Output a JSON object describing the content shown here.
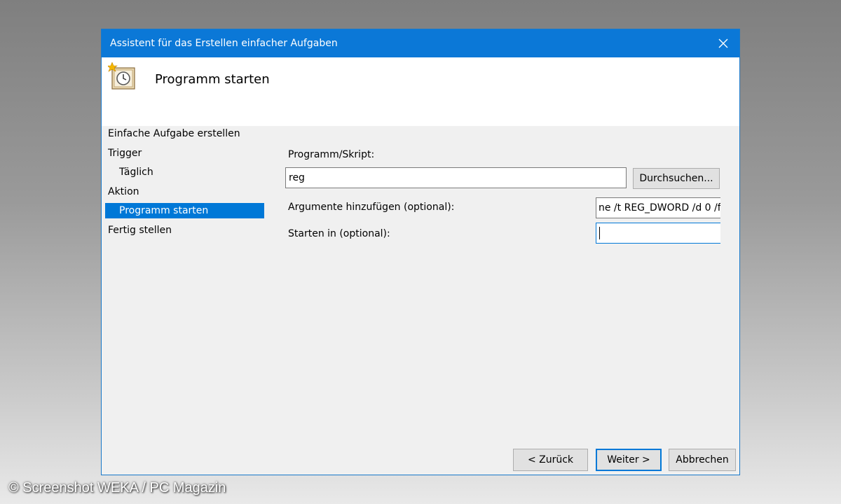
{
  "window": {
    "title": "Assistent für das Erstellen einfacher Aufgaben",
    "close_icon": "close-icon"
  },
  "header": {
    "title": "Programm starten",
    "icon": "task-scheduler-clock-icon"
  },
  "nav": {
    "items": [
      {
        "label": "Einfache Aufgabe erstellen"
      },
      {
        "label": "Trigger"
      },
      {
        "label": "Täglich"
      },
      {
        "label": "Aktion"
      },
      {
        "label": "Programm starten"
      },
      {
        "label": "Fertig stellen"
      }
    ]
  },
  "form": {
    "program_label": "Programm/Skript:",
    "program_value": "reg",
    "browse_button": "Durchsuchen...",
    "arguments_label": "Argumente hinzufügen (optional):",
    "arguments_value": "ne /t REG_DWORD /d 0 /f",
    "start_in_label": "Starten in (optional):",
    "start_in_value": ""
  },
  "footer": {
    "back_button": "< Zurück",
    "next_button": "Weiter >",
    "cancel_button": "Abbrechen"
  },
  "watermark": "© Screenshot WEKA / PC Magazin",
  "colors": {
    "titlebar": "#0b78d7",
    "selection": "#0078d7",
    "dialog_bg": "#f0f0f0"
  }
}
